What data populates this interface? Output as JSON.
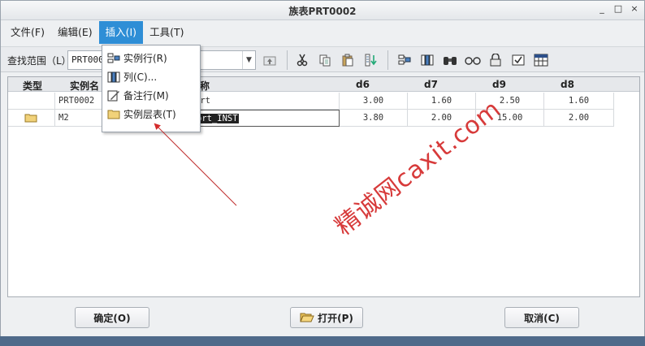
{
  "window": {
    "title": "族表PRT0002",
    "controls": [
      "_",
      "□",
      "×"
    ]
  },
  "menubar": {
    "items": [
      {
        "label": "文件(F)"
      },
      {
        "label": "编辑(E)"
      },
      {
        "label": "插入(I)"
      },
      {
        "label": "工具(T)"
      }
    ]
  },
  "toolbar": {
    "find_label": "查找范围（L）:",
    "find_value": "PRT0002"
  },
  "dropdown": {
    "items": [
      {
        "label": "实例行(R)",
        "icon": "instance-row-icon"
      },
      {
        "label": "列(C)...",
        "icon": "column-icon"
      },
      {
        "label": "备注行(M)",
        "icon": "comment-row-icon"
      },
      {
        "label": "实例层表(T)",
        "icon": "folder-icon"
      }
    ]
  },
  "table": {
    "headers": [
      "类型",
      "实例名",
      "称",
      "d6",
      "d7",
      "d9",
      "d8"
    ],
    "rows": [
      {
        "type": "",
        "instance": "PRT0002",
        "name": "ort",
        "d6": "3.00",
        "d7": "1.60",
        "d9": "2.50",
        "d8": "1.60"
      },
      {
        "type": "folder",
        "instance": "M2",
        "name": "ort_INST",
        "d6": "3.80",
        "d7": "2.00",
        "d9": "15.00",
        "d8": "2.00"
      }
    ]
  },
  "buttons": {
    "ok": "确定(O)",
    "open": "打开(P)",
    "cancel": "取消(C)"
  },
  "watermark": "精诚网caxit.com",
  "colors": {
    "menu_active": "#2e8ed6",
    "watermark": "#d42a2a"
  }
}
